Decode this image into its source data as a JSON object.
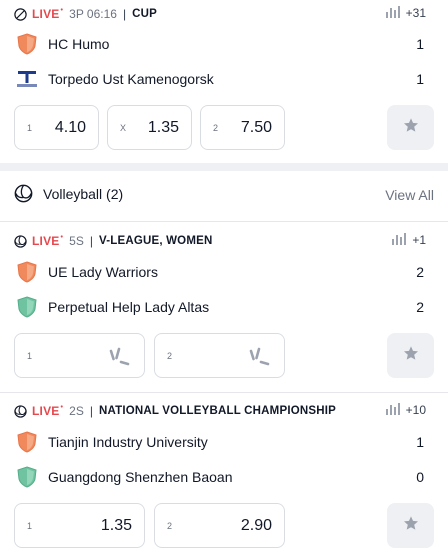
{
  "match1": {
    "live_label": "LIVE",
    "live_dot": "•",
    "time": "3P 06:16",
    "league": "CUP",
    "stats_count": "+31",
    "home": {
      "name": "HC Humo",
      "score": "1"
    },
    "away": {
      "name": "Torpedo Ust Kamenogorsk",
      "score": "1"
    },
    "odds": [
      {
        "label": "1",
        "value": "4.10"
      },
      {
        "label": "X",
        "value": "1.35"
      },
      {
        "label": "2",
        "value": "7.50"
      }
    ]
  },
  "section": {
    "title": "Volleyball (2)",
    "view_all": "View All"
  },
  "match2": {
    "live_label": "LIVE",
    "live_dot": "•",
    "time": "5S",
    "league": "V-LEAGUE, WOMEN",
    "stats_count": "+1",
    "home": {
      "name": "UE Lady Warriors",
      "score": "2"
    },
    "away": {
      "name": "Perpetual Help Lady Altas",
      "score": "2"
    },
    "odds": [
      {
        "label": "1",
        "value": ""
      },
      {
        "label": "2",
        "value": ""
      }
    ]
  },
  "match3": {
    "live_label": "LIVE",
    "live_dot": "•",
    "time": "2S",
    "league": "NATIONAL VOLLEYBALL CHAMPIONSHIP",
    "stats_count": "+10",
    "home": {
      "name": "Tianjin Industry University",
      "score": "1"
    },
    "away": {
      "name": "Guangdong Shenzhen Baoan",
      "score": "0"
    },
    "odds": [
      {
        "label": "1",
        "value": "1.35"
      },
      {
        "label": "2",
        "value": "2.90"
      }
    ]
  },
  "colors": {
    "live": "#e5484d",
    "crest_orange": "#f08a5d",
    "crest_green": "#6fc3a0",
    "star": "#9ca3af"
  }
}
